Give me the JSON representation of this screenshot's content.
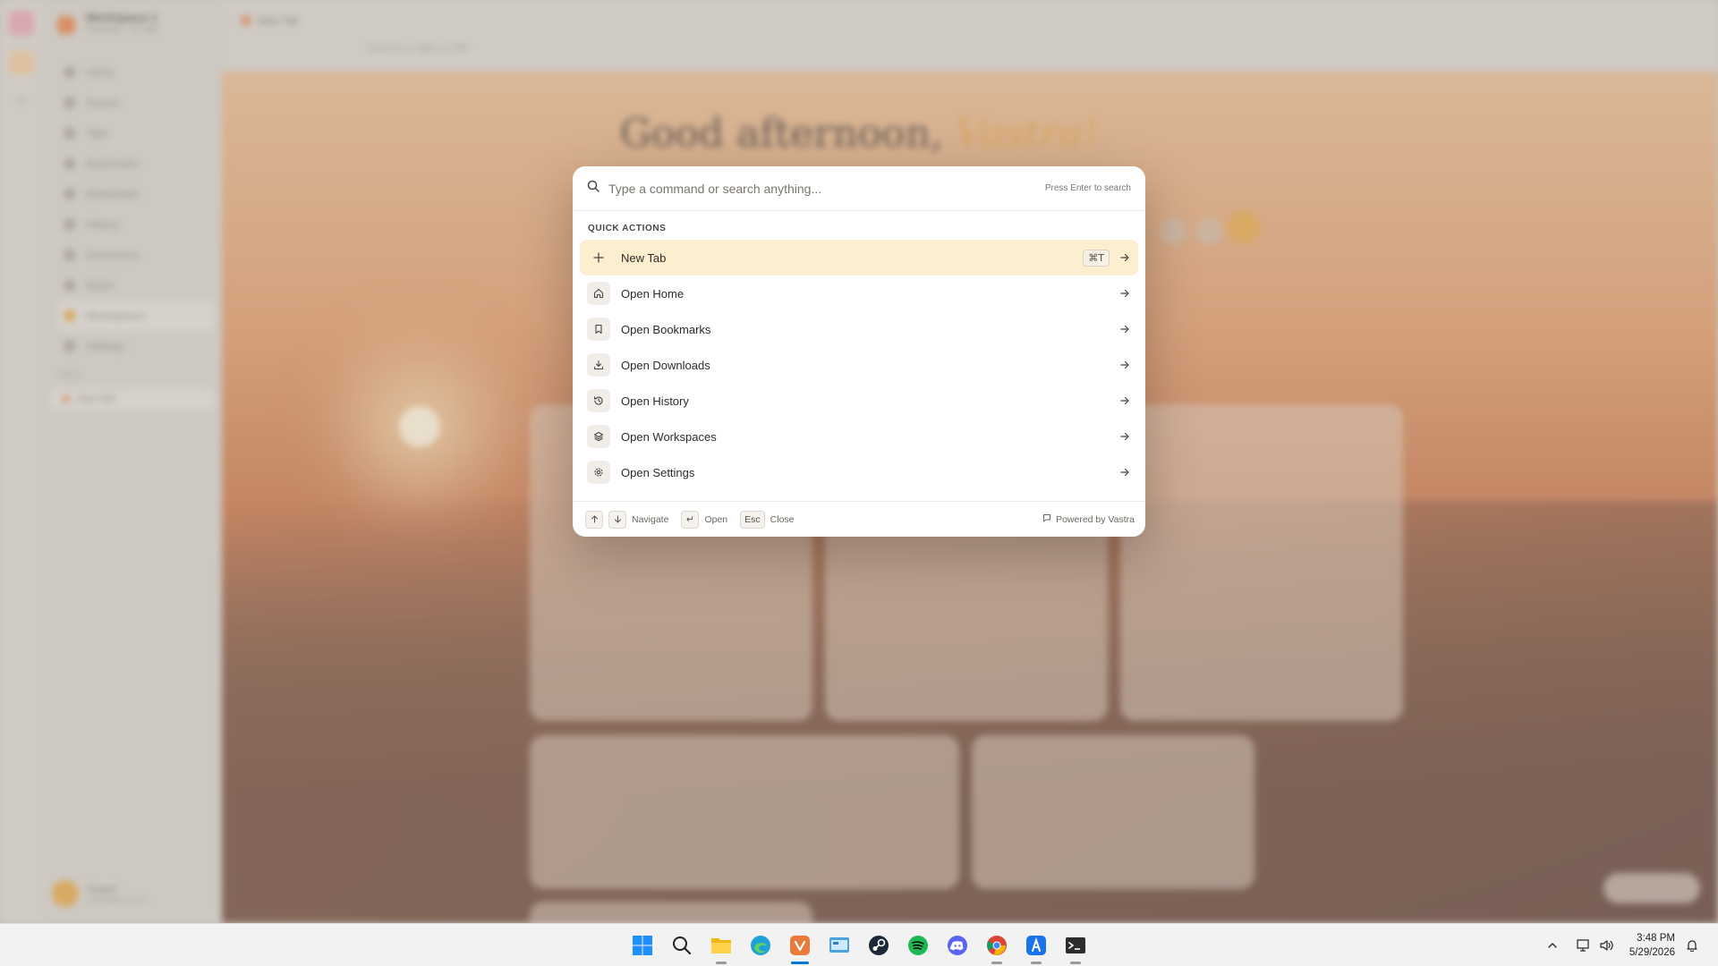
{
  "background": {
    "workspace_name": "Workspace 1",
    "workspace_sub": "Personal · 42 tabs",
    "nav": [
      "Home",
      "Search",
      "Tabs",
      "Bookmarks",
      "Downloads",
      "History",
      "Extensions",
      "Notes",
      "Workspaces",
      "Settings"
    ],
    "tabs_label": "TABS",
    "side_tab": "New Tab",
    "top_tab": "New Tab",
    "url_placeholder": "Search or type a URL",
    "greeting": "Good afternoon,",
    "greeting_name": "Vastra!",
    "user_name": "Guest",
    "user_sub": "guest@vastra.io"
  },
  "palette": {
    "search_placeholder": "Type a command or search anything...",
    "search_hint": "Press Enter to search",
    "section_label": "QUICK ACTIONS",
    "items": [
      {
        "label": "New Tab",
        "icon": "plus-icon",
        "shortcut": "⌘T",
        "selected": true
      },
      {
        "label": "Open Home",
        "icon": "home-icon"
      },
      {
        "label": "Open Bookmarks",
        "icon": "bookmark-icon"
      },
      {
        "label": "Open Downloads",
        "icon": "download-icon"
      },
      {
        "label": "Open History",
        "icon": "history-icon"
      },
      {
        "label": "Open Workspaces",
        "icon": "layers-icon"
      },
      {
        "label": "Open Settings",
        "icon": "gear-icon"
      }
    ],
    "footer": {
      "navigate": "Navigate",
      "open_key": "↵",
      "open": "Open",
      "close_key": "Esc",
      "close": "Close",
      "powered": "Powered by Vastra"
    },
    "colors": {
      "selected_bg": "#fbefd0",
      "accent": "#e89a3a"
    }
  },
  "taskbar": {
    "time": "3:48 PM",
    "date": "5/29/2026",
    "apps": [
      "start-icon",
      "search-icon",
      "file-explorer-icon",
      "edge-icon",
      "vastra-icon",
      "control-panel-icon",
      "steam-icon",
      "spotify-icon",
      "discord-icon",
      "chrome-icon",
      "app-store-icon",
      "terminal-icon"
    ]
  }
}
